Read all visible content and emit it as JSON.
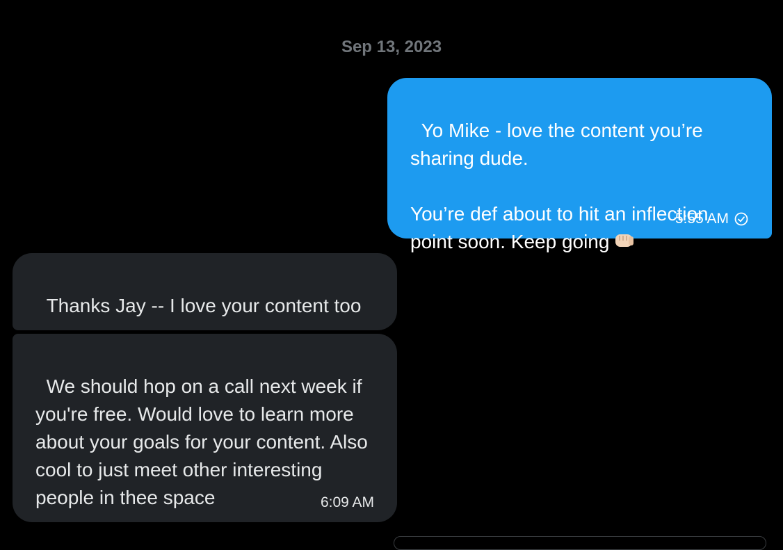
{
  "conversation": {
    "date_separator": "Sep 13, 2023",
    "messages": [
      {
        "direction": "sent",
        "text": "Yo Mike - love the content you’re sharing dude.\n\nYou’re def about to hit an inflection point soon. Keep going",
        "emoji": "fist-bump-icon",
        "time": "5:55 AM",
        "status_icon": "check-circle-icon"
      },
      {
        "direction": "received",
        "text": "Thanks Jay -- I love your content too"
      },
      {
        "direction": "received",
        "text": "We should hop on a call next week if you're free. Would love to learn more about your goals for your content. Also cool to just meet other interesting people in thee space",
        "time": "6:09 AM"
      }
    ]
  },
  "colors": {
    "background": "#000000",
    "sent_bubble": "#1d9bf0",
    "received_bubble": "#202327",
    "date_text": "#71767b"
  }
}
